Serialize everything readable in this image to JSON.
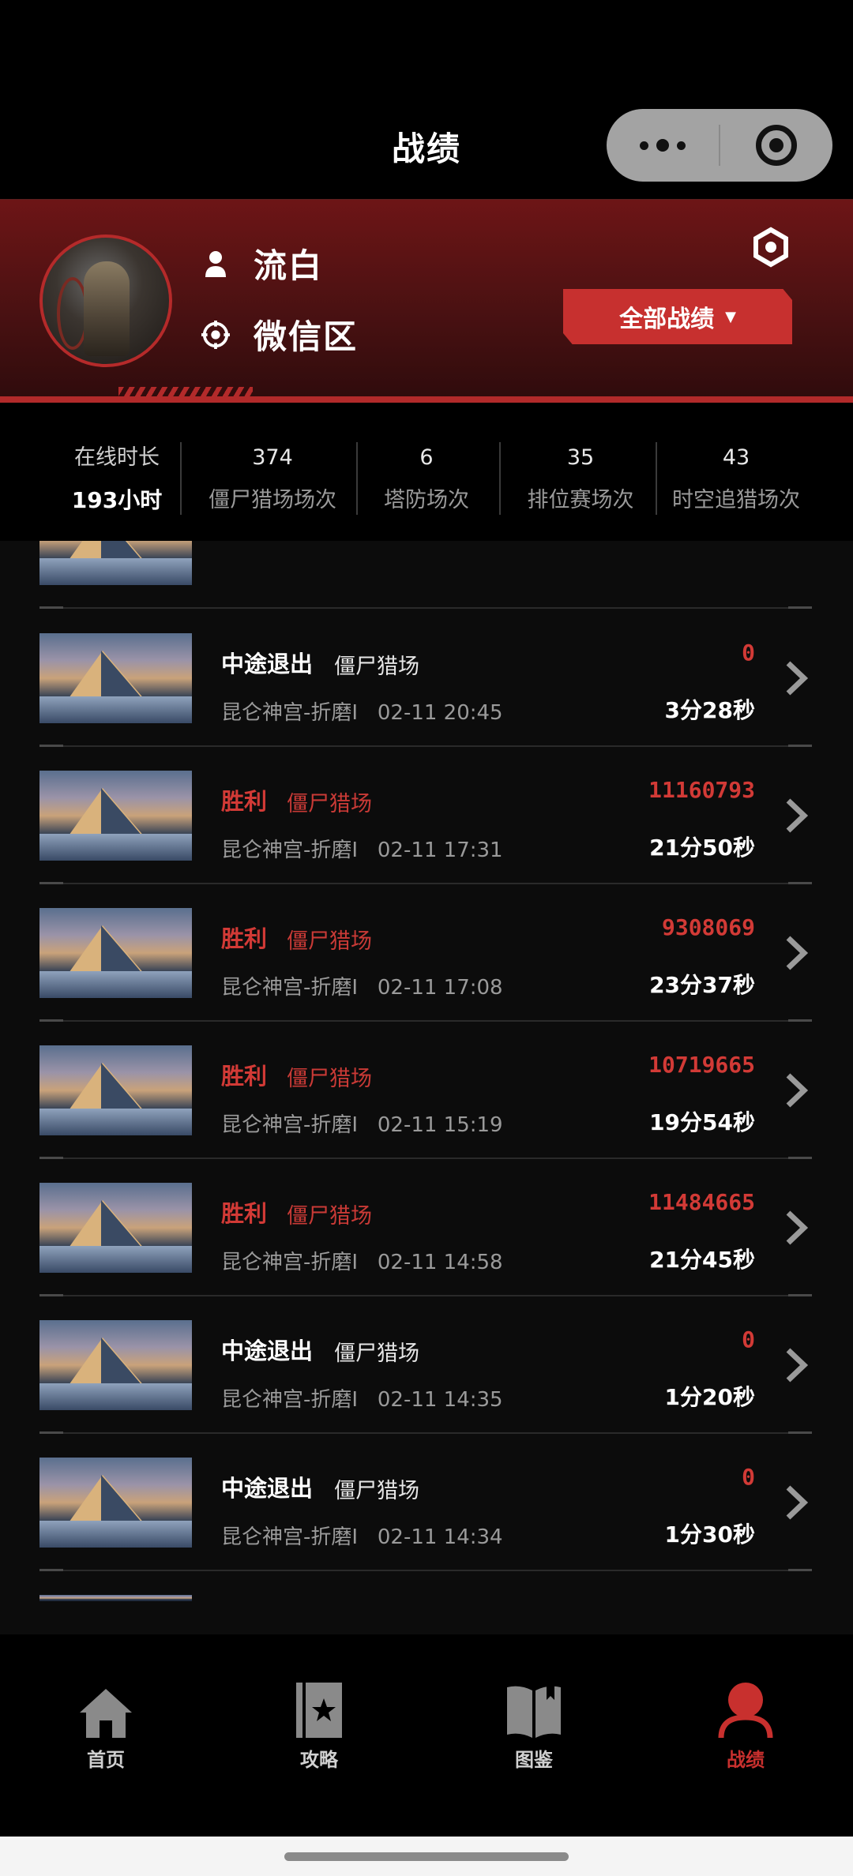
{
  "header": {
    "title": "战绩"
  },
  "profile": {
    "name": "流白",
    "region": "微信区",
    "filter_label": "全部战绩",
    "filter_caret": "▼"
  },
  "stats": [
    {
      "value": "在线时长",
      "label": "193小时"
    },
    {
      "value": "374",
      "label": "僵尸猎场场次"
    },
    {
      "value": "6",
      "label": "塔防场次"
    },
    {
      "value": "35",
      "label": "排位赛场次"
    },
    {
      "value": "43",
      "label": "时空追猎场次"
    }
  ],
  "records": [
    {
      "result": "中途退出",
      "mode": "僵尸猎场",
      "place": "昆仑神宫-折磨I",
      "time": "02-11 20:45",
      "score": "0",
      "duration": "3分28秒",
      "win": false
    },
    {
      "result": "胜利",
      "mode": "僵尸猎场",
      "place": "昆仑神宫-折磨I",
      "time": "02-11 17:31",
      "score": "11160793",
      "duration": "21分50秒",
      "win": true
    },
    {
      "result": "胜利",
      "mode": "僵尸猎场",
      "place": "昆仑神宫-折磨I",
      "time": "02-11 17:08",
      "score": "9308069",
      "duration": "23分37秒",
      "win": true
    },
    {
      "result": "胜利",
      "mode": "僵尸猎场",
      "place": "昆仑神宫-折磨I",
      "time": "02-11 15:19",
      "score": "10719665",
      "duration": "19分54秒",
      "win": true
    },
    {
      "result": "胜利",
      "mode": "僵尸猎场",
      "place": "昆仑神宫-折磨I",
      "time": "02-11 14:58",
      "score": "11484665",
      "duration": "21分45秒",
      "win": true
    },
    {
      "result": "中途退出",
      "mode": "僵尸猎场",
      "place": "昆仑神宫-折磨I",
      "time": "02-11 14:35",
      "score": "0",
      "duration": "1分20秒",
      "win": false
    },
    {
      "result": "中途退出",
      "mode": "僵尸猎场",
      "place": "昆仑神宫-折磨I",
      "time": "02-11 14:34",
      "score": "0",
      "duration": "1分30秒",
      "win": false
    }
  ],
  "tabs": [
    {
      "label": "首页",
      "icon": "home-icon"
    },
    {
      "label": "攻略",
      "icon": "guide-book-icon"
    },
    {
      "label": "图鉴",
      "icon": "open-book-icon"
    },
    {
      "label": "战绩",
      "icon": "user-icon",
      "active": true
    }
  ],
  "colors": {
    "accent": "#c8302e",
    "background": "#0c0c0c",
    "header_gradient": "#6d1516"
  }
}
